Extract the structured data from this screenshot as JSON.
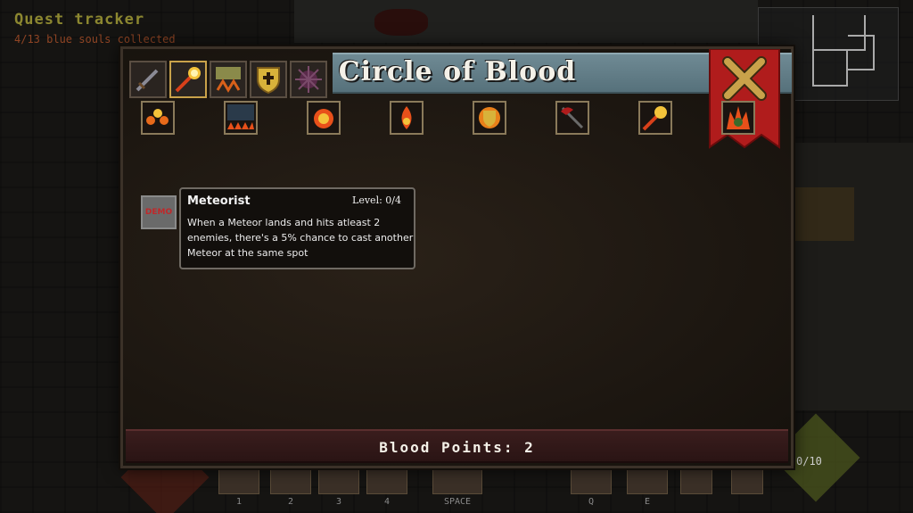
{
  "hud": {
    "quest_title": "Quest tracker",
    "quest_progress": "4/13 blue souls collected",
    "right_gauge": "0/10"
  },
  "hotbar": {
    "slots": [
      {
        "key": "1",
        "icon": "fireball-icon"
      },
      {
        "key": "2",
        "icon": "meteor-rain-icon"
      },
      {
        "key": "3",
        "icon": "shield-cross-icon"
      },
      {
        "key": "4",
        "icon": "spiked-ball-icon"
      },
      {
        "key": "SPACE",
        "icon": "dash-icon"
      },
      {
        "key": "Q",
        "icon": "potion-icon"
      },
      {
        "key": "E",
        "icon": "health-potion-icon"
      }
    ]
  },
  "modal": {
    "title": "Circle of Blood",
    "close_icon": "close-x-icon",
    "tabs": [
      {
        "icon": "sword-icon"
      },
      {
        "icon": "fireball-icon",
        "active": true
      },
      {
        "icon": "meteor-rain-icon"
      },
      {
        "icon": "shield-cross-icon"
      },
      {
        "icon": "spiked-ball-icon"
      }
    ],
    "skills": [
      {
        "icon": "triple-flame-icon"
      },
      {
        "icon": "fire-wall-icon"
      },
      {
        "icon": "flame-burst-icon"
      },
      {
        "icon": "flame-drop-icon"
      },
      {
        "icon": "flame-shield-icon"
      },
      {
        "icon": "fire-axe-icon"
      },
      {
        "icon": "meteor-icon"
      },
      {
        "icon": "fire-demon-icon"
      }
    ],
    "locked_label": "DEMO",
    "tooltip": {
      "name": "Meteorist",
      "level": "Level: 0/4",
      "description": "When a Meteor lands and hits atleast 2 enemies, there's a 5% chance to cast another Meteor at the same spot"
    },
    "footer": "Blood Points: 2"
  },
  "colors": {
    "accent_gold": "#c9a24a",
    "title_bar": "#6f8a94",
    "banner_red": "#b01c1c",
    "footer_red": "#3a1d1d",
    "demo_red": "#c0282a"
  }
}
